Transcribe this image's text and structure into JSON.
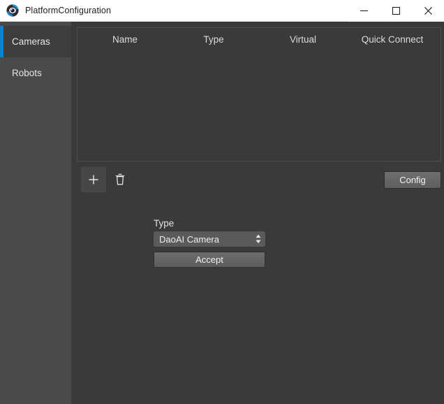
{
  "window": {
    "title": "PlatformConfiguration",
    "app_icon": "daoai-eye-logo-icon",
    "controls": {
      "minimize": "minimize-icon",
      "maximize": "maximize-icon",
      "close": "close-icon"
    }
  },
  "sidebar": {
    "items": [
      {
        "label": "Cameras",
        "active": true
      },
      {
        "label": "Robots",
        "active": false
      }
    ]
  },
  "table": {
    "columns": [
      "Name",
      "Type",
      "Virtual",
      "Quick Connect"
    ],
    "rows": []
  },
  "toolbar": {
    "add_icon": "plus-icon",
    "delete_icon": "trash-icon",
    "config_label": "Config"
  },
  "form": {
    "type_label": "Type",
    "type_value": "DaoAI Camera",
    "type_options": [
      "DaoAI Camera"
    ],
    "spinner_icon": "up-down-arrows-icon",
    "accept_label": "Accept"
  },
  "colors": {
    "accent_blue": "#0b84cf",
    "titlebar_bg": "#ffffff",
    "sidebar_bg": "#4a4a4a",
    "content_bg": "#3a3a3a",
    "button_face": "#656565"
  }
}
